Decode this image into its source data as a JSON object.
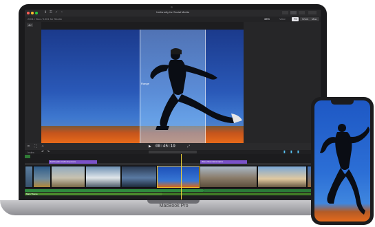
{
  "app": {
    "title": "Uniformity for Social Media",
    "library_label": "2001 / Boo / 1001 for Studio",
    "window_zoom": "33%",
    "view_label": "View"
  },
  "subbar": {
    "buttons": [
      "Fit",
      "Work",
      "Mac"
    ],
    "left_label": "4K"
  },
  "viewer": {
    "scope_tag": "Range"
  },
  "controls": {
    "timecode": "00:45:19",
    "left_label": "Index"
  },
  "timeline": {
    "connected_clips": [
      {
        "label": "Earthquake Audio Exposure",
        "color": "#7b52c9"
      },
      {
        "label": "Wave Mountains Alpine",
        "color": "#7b52c9"
      },
      {
        "label": "Solo Dance Track",
        "color": "#2f7a36"
      }
    ],
    "audio_label": "Main Theme"
  },
  "device": {
    "laptop_label": "MacBook Pro"
  },
  "colors": {
    "accent": "#f0c02a",
    "sky": "#2a59b8",
    "ground": "#e86a1a"
  }
}
